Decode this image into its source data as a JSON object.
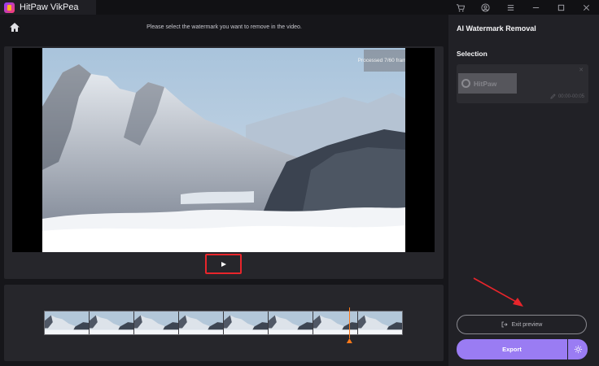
{
  "app": {
    "name": "HitPaw VikPea"
  },
  "window_controls": [
    "cart-icon",
    "account-icon",
    "menu-icon",
    "minimize-icon",
    "maximize-icon",
    "close-icon"
  ],
  "main": {
    "instruction": "Please select the watermark you want to remove in the video.",
    "processed_badge": "Processed 7/60 frames",
    "timeline": {
      "thumbnail_count": 8,
      "playhead_fraction": 0.85
    }
  },
  "sidebar": {
    "title": "AI Watermark Removal",
    "selection_label": "Selection",
    "selection_card": {
      "watermark_text": "HitPaw",
      "time_range": "00:00-00:05"
    },
    "exit_preview_label": "Exit preview",
    "export_label": "Export"
  },
  "colors": {
    "accent": "#9a7cf3",
    "highlight_box": "#e8252b",
    "playhead": "#ff7a1a"
  }
}
